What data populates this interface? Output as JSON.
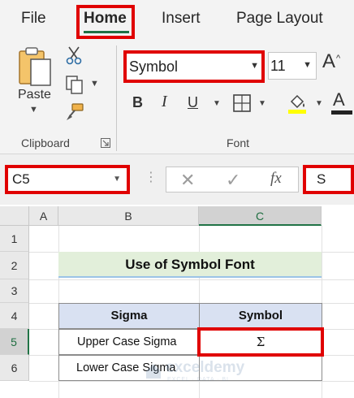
{
  "tabs": [
    {
      "label": "File"
    },
    {
      "label": "Home"
    },
    {
      "label": "Insert"
    },
    {
      "label": "Page Layout"
    }
  ],
  "ribbon": {
    "clipboard": {
      "group_label": "Clipboard",
      "paste_label": "Paste"
    },
    "font": {
      "group_label": "Font",
      "font_name": "Symbol",
      "font_size": "11"
    },
    "icons": [
      "paste-icon",
      "cut-icon",
      "copy-icon",
      "format-painter-icon",
      "dialog-launcher-icon",
      "grow-font-icon",
      "bold-icon",
      "italic-icon",
      "underline-icon",
      "borders-icon",
      "fill-color-icon",
      "font-color-icon"
    ]
  },
  "formula_bar": {
    "name_box": "C5",
    "formula": "S"
  },
  "sheet": {
    "columns": [
      "A",
      "B",
      "C"
    ],
    "rows": [
      "1",
      "2",
      "3",
      "4",
      "5",
      "6"
    ],
    "title": "Use of Symbol Font",
    "table": {
      "headers": [
        "Sigma",
        "Symbol"
      ],
      "rows": [
        [
          "Upper Case Sigma",
          "Σ"
        ],
        [
          "Lower Case Sigma",
          ""
        ]
      ]
    },
    "watermark": {
      "name": "exceldemy",
      "tagline": "EXCEL · DATA · BI"
    }
  },
  "colors": {
    "highlight": "#e00000",
    "excel_green": "#217346",
    "title_fill": "#e2efda",
    "header_fill": "#d9e1f2"
  }
}
